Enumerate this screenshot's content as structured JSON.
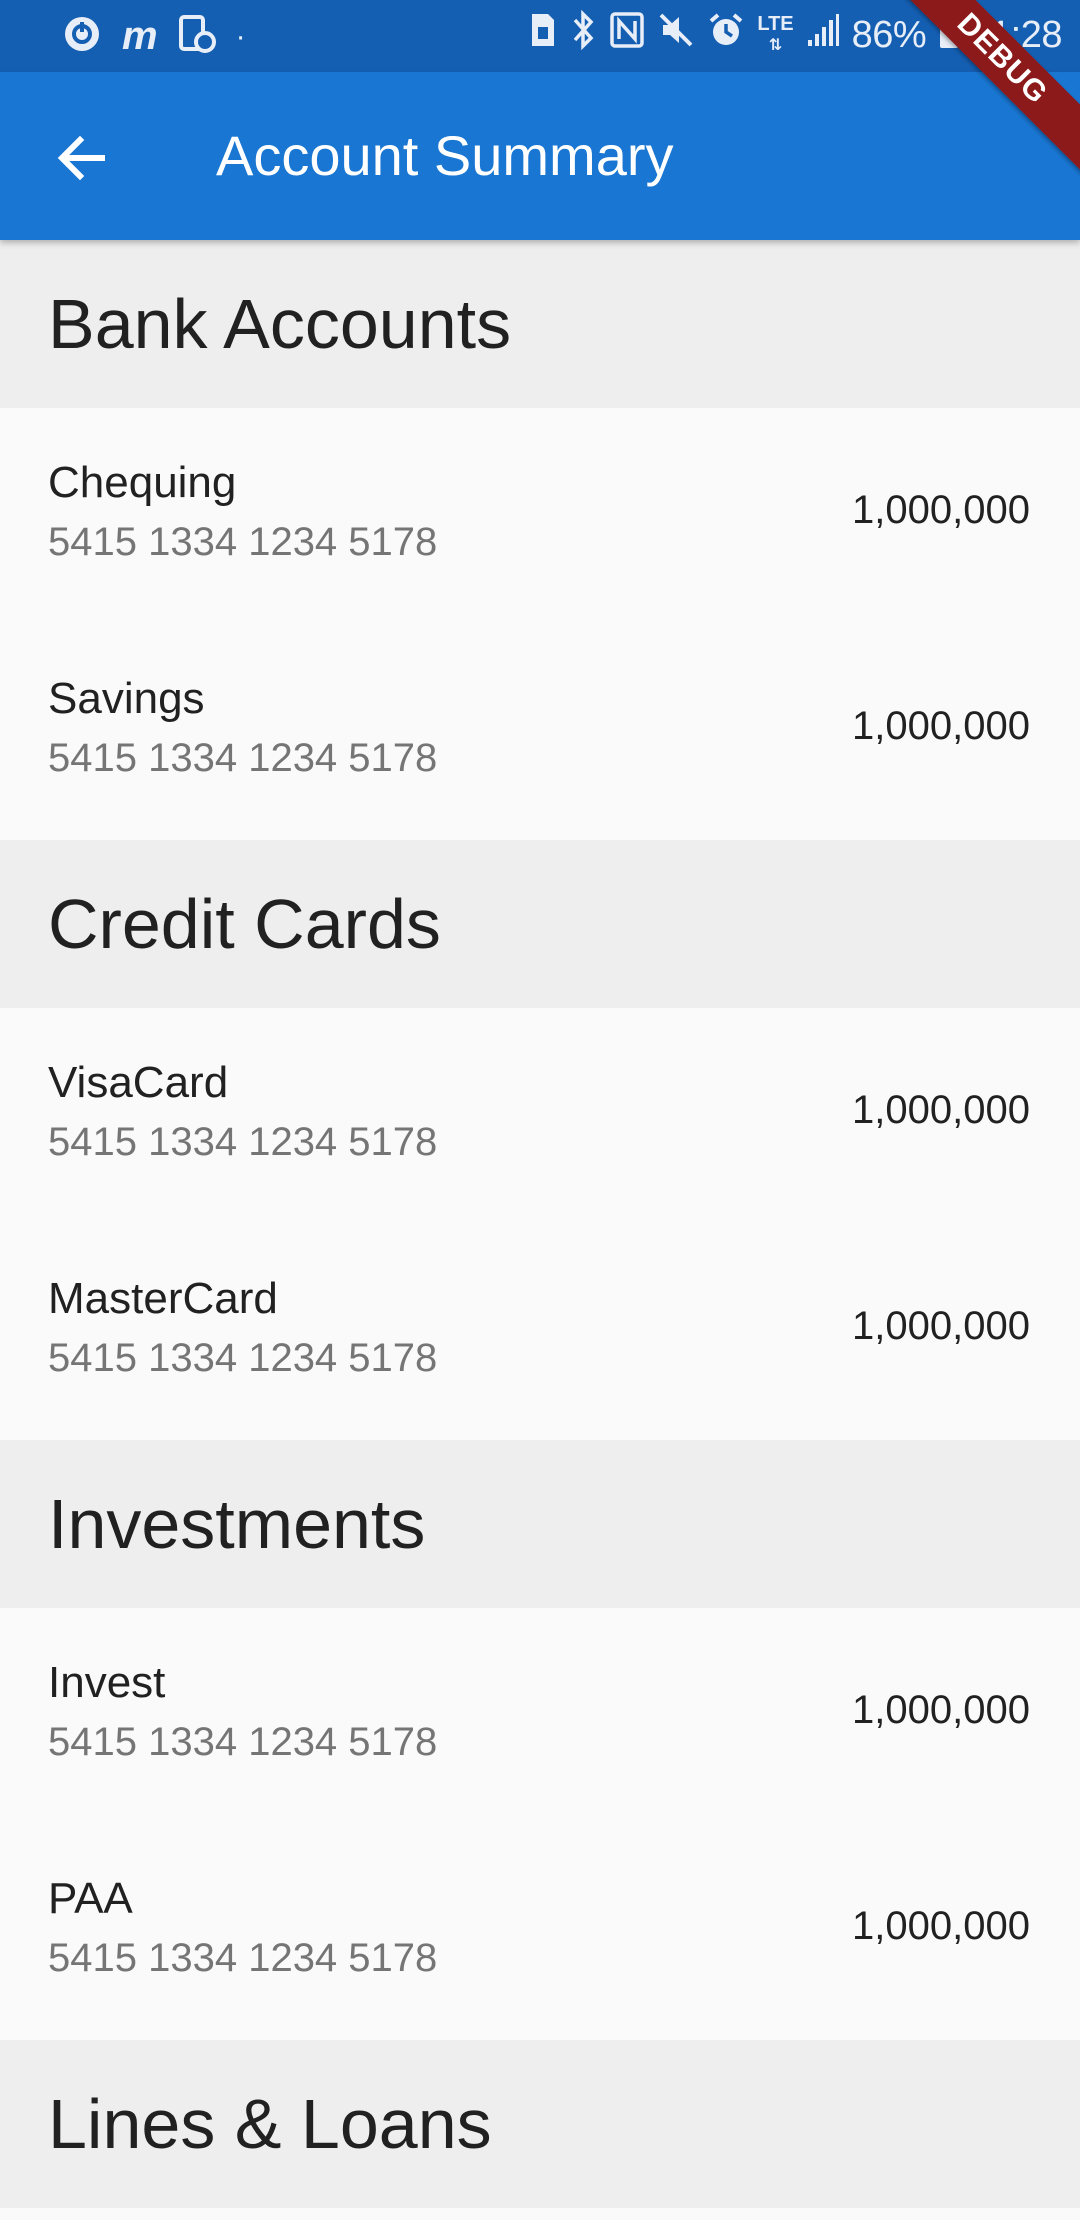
{
  "status_bar": {
    "battery": "86%",
    "time": "11:28",
    "network": "LTE",
    "icons": [
      "sync-icon",
      "m-app-icon",
      "screen-icon",
      "dot-icon",
      "sim-icon",
      "bluetooth-icon",
      "nfc-icon",
      "mute-icon",
      "alarm-icon",
      "lte-icon",
      "signal-icon",
      "battery-icon"
    ]
  },
  "app_bar": {
    "title": "Account Summary",
    "back_icon": "arrow-back-icon",
    "color": "#1976d2"
  },
  "debug_banner": "DEBUG",
  "sections": [
    {
      "title": "Bank Accounts",
      "accounts": [
        {
          "name": "Chequing",
          "number": "5415 1334 1234 5178",
          "balance": "1,000,000"
        },
        {
          "name": "Savings",
          "number": "5415 1334 1234 5178",
          "balance": "1,000,000"
        }
      ]
    },
    {
      "title": "Credit Cards",
      "accounts": [
        {
          "name": "VisaCard",
          "number": "5415 1334 1234 5178",
          "balance": "1,000,000"
        },
        {
          "name": "MasterCard",
          "number": "5415 1334 1234 5178",
          "balance": "1,000,000"
        }
      ]
    },
    {
      "title": "Investments",
      "accounts": [
        {
          "name": "Invest",
          "number": "5415 1334 1234 5178",
          "balance": "1,000,000"
        },
        {
          "name": "PAA",
          "number": "5415 1334 1234 5178",
          "balance": "1,000,000"
        }
      ]
    },
    {
      "title": "Lines & Loans",
      "accounts": []
    }
  ]
}
